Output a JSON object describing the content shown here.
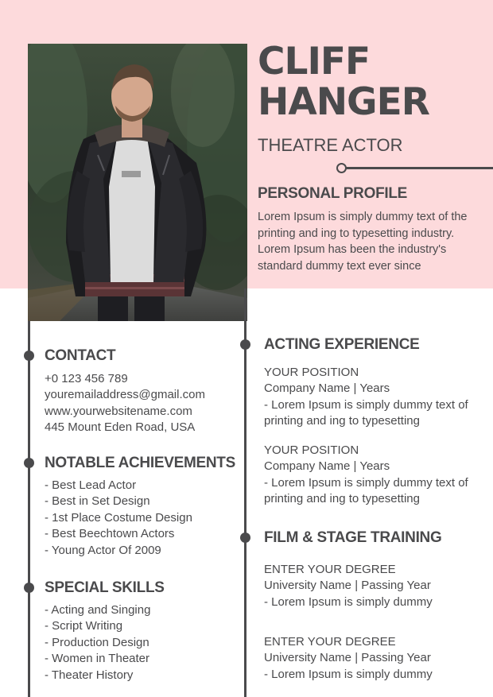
{
  "header": {
    "first_name": "CLIFF",
    "last_name": "HANGER",
    "role": "THEATRE ACTOR"
  },
  "profile": {
    "title": "PERSONAL PROFILE",
    "lines": [
      "Lorem Ipsum is simply dummy text of the",
      "printing and ing to typesetting industry.",
      "Lorem Ipsum has been the industry's",
      "standard dummy text ever since"
    ]
  },
  "contact": {
    "title": "CONTACT",
    "phone": "+0 123 456 789",
    "email": "youremailaddress@gmail.com",
    "website": "www.yourwebsitename.com",
    "address": "445 Mount Eden Road, USA"
  },
  "achievements": {
    "title": "NOTABLE ACHIEVEMENTS",
    "items": [
      "- Best Lead Actor",
      "- Best in Set Design",
      "- 1st Place Costume Design",
      "- Best Beechtown Actors",
      "- Young Actor Of 2009"
    ]
  },
  "skills": {
    "title": "SPECIAL SKILLS",
    "items": [
      "- Acting and Singing",
      "- Script Writing",
      "- Production Design",
      "- Women in Theater",
      "- Theater History"
    ]
  },
  "experience": {
    "title": "ACTING EXPERIENCE",
    "entries": [
      {
        "position": "YOUR  POSITION",
        "company": "Company Name | Years",
        "line1": "- Lorem Ipsum is simply dummy text of",
        "line2": "printing and ing to typesetting"
      },
      {
        "position": "YOUR  POSITION",
        "company": "Company Name | Years",
        "line1": "- Lorem Ipsum is simply dummy text of",
        "line2": "printing and ing to typesetting"
      }
    ]
  },
  "training": {
    "title": "FILM & STAGE TRAINING",
    "entries": [
      {
        "degree": "ENTER YOUR DEGREE",
        "school": "University Name | Passing Year",
        "desc": "- Lorem Ipsum is simply dummy"
      },
      {
        "degree": "ENTER YOUR DEGREE",
        "school": "University Name | Passing Year",
        "desc": "- Lorem Ipsum is simply dummy"
      }
    ]
  },
  "colors": {
    "accent_pink": "#fddadc",
    "text_dark": "#4a4a4c"
  }
}
